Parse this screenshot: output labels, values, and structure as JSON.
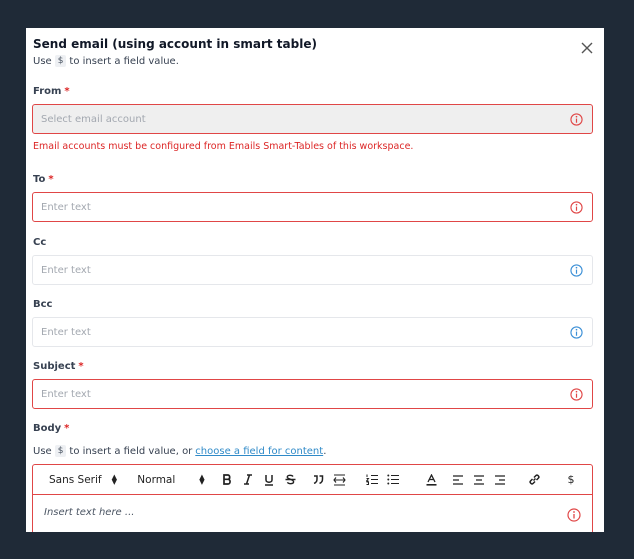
{
  "dialog": {
    "title": "Send email (using account in smart table)",
    "subtitle_prefix": "Use",
    "subtitle_chip": "$",
    "subtitle_suffix": "to insert a field value."
  },
  "fields": {
    "from": {
      "label": "From",
      "required": "*",
      "placeholder": "Select email account",
      "error": "Email accounts must be configured from Emails Smart-Tables of this workspace."
    },
    "to": {
      "label": "To",
      "required": "*",
      "placeholder": "Enter text"
    },
    "cc": {
      "label": "Cc",
      "placeholder": "Enter text"
    },
    "bcc": {
      "label": "Bcc",
      "placeholder": "Enter text"
    },
    "subject": {
      "label": "Subject",
      "required": "*",
      "placeholder": "Enter text"
    },
    "body": {
      "label": "Body",
      "required": "*",
      "help_prefix": "Use",
      "help_chip": "$",
      "help_middle": "to insert a field value, or",
      "help_link": "choose a field for content",
      "help_end": ".",
      "font_select": "Sans Serif",
      "size_select": "Normal",
      "placeholder": "Insert text here ...",
      "dollar_button": "$"
    }
  },
  "colors": {
    "error": "#e04646",
    "info": "#3b8fd6",
    "link": "#2f8ac8",
    "backdrop": "#1f2a37"
  },
  "icons": [
    "close-icon",
    "error-info-icon",
    "info-icon",
    "bold-icon",
    "italic-icon",
    "underline-icon",
    "strike-icon",
    "blockquote-icon",
    "code-block-icon",
    "ordered-list-icon",
    "bullet-list-icon",
    "text-color-icon",
    "align-left-icon",
    "align-center-icon",
    "align-right-icon",
    "link-icon"
  ]
}
